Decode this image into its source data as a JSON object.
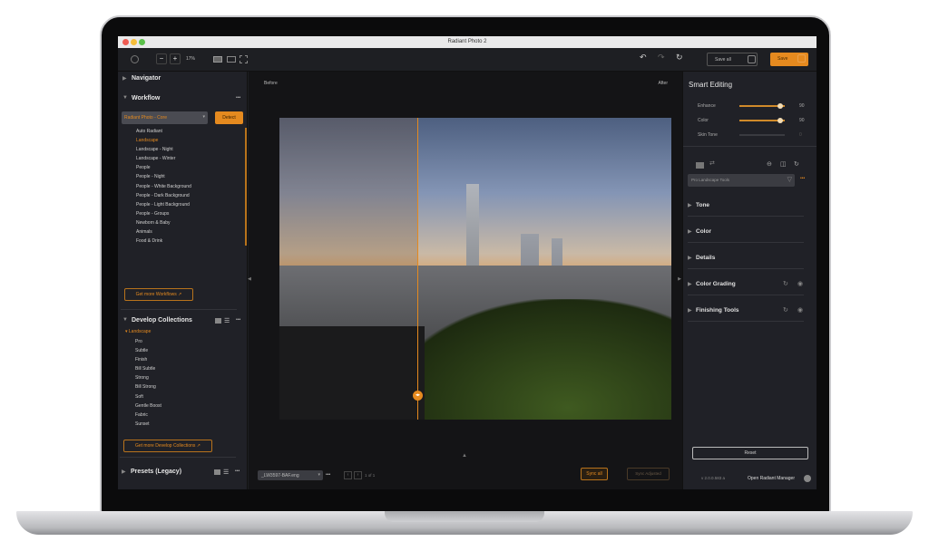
{
  "window": {
    "title": "Radiant Photo 2"
  },
  "toolbar": {
    "zoom_minus": "−",
    "zoom_plus": "+",
    "zoom_level": "17%",
    "save_all": "Save all",
    "save": "Save"
  },
  "compare": {
    "before": "Before",
    "after": "After"
  },
  "navigator": {
    "title": "Navigator"
  },
  "workflow": {
    "title": "Workflow",
    "more": "•••",
    "selected": "Radiant Photo - Core",
    "detect": "Detect",
    "items": [
      "Auto Radiant",
      "Landscape",
      "Landscape - Night",
      "Landscape - Winter",
      "People",
      "People - Night",
      "People - White Background",
      "People - Dark Background",
      "People - Light Background",
      "People - Groups",
      "Newborn & Baby",
      "Animals",
      "Food & Drink"
    ],
    "active_item": "Landscape",
    "get_more": "Get more Workflows"
  },
  "collections": {
    "title": "Develop Collections",
    "more": "•••",
    "group": "Landscape",
    "items": [
      "Pro",
      "Subtle",
      "Finish",
      "Bill Subtle",
      "Strong",
      "Bill Strong",
      "Soft",
      "Gentle Boost",
      "Fabric",
      "Sunset"
    ],
    "get_more": "Get more Develop Collections"
  },
  "presets": {
    "title": "Presets (Legacy)",
    "more": "•••"
  },
  "smart": {
    "title": "Smart Editing",
    "sliders": [
      {
        "label": "Enhance",
        "value": 90
      },
      {
        "label": "Color",
        "value": 90
      },
      {
        "label": "Skin Tone",
        "value": 0
      }
    ]
  },
  "tools": {
    "preset": "Pro Landscape Tools",
    "more": "•••",
    "sections": [
      "Tone",
      "Color",
      "Details",
      "Color Grading",
      "Finishing Tools"
    ]
  },
  "bottom": {
    "filename": "_LW3597-BAF.eng",
    "more": "•••",
    "page": "1 of 1",
    "sync_all": "Sync all",
    "sync_adjusted": "Sync Adjusted",
    "reset": "Reset",
    "version": "v 2.0.0.583 a",
    "manager": "Open Radiant Manager"
  },
  "colors": {
    "accent": "#e58a1f",
    "panel": "#202127",
    "canvas": "#141416"
  }
}
